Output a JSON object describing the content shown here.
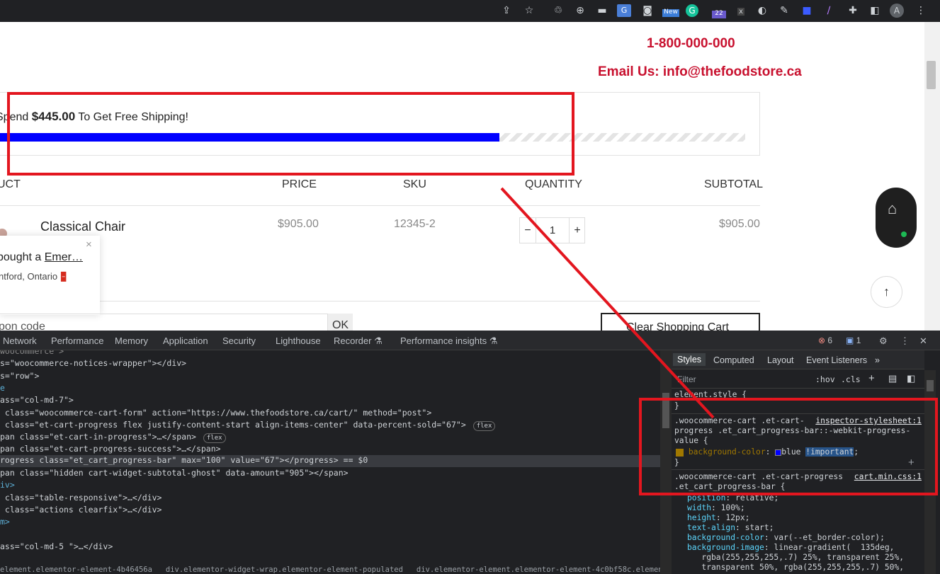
{
  "browser_toolbar": {
    "icons": [
      "share-icon",
      "star-icon",
      "extension-recycle-icon",
      "globe-icon",
      "extension-car-icon",
      "translate-icon",
      "camera-icon",
      "new-extension-icon",
      "grammarly-icon",
      "extension-cap-icon",
      "extension-x-icon",
      "extension-s-icon",
      "pen-icon",
      "video-icon",
      "feather-icon",
      "puzzle-icon",
      "sidebar-icon",
      "profile-avatar",
      "kebab-menu-icon"
    ],
    "new_badge": "New",
    "count_badge": "22",
    "x_badge": "x",
    "avatar_letter": "A"
  },
  "page": {
    "phone": "1-800-000-000",
    "email": "Email Us: info@thefoodstore.ca",
    "shipping": {
      "prefix": "Spend ",
      "amount": "$445.00",
      "suffix": " To Get Free Shipping!",
      "progress_percent": 67
    },
    "table": {
      "headers": [
        "UCT",
        "PRICE",
        "SKU",
        "QUANTITY",
        "SUBTOTAL"
      ],
      "row": {
        "product": "Classical Chair",
        "price": "$905.00",
        "sku": "12345-2",
        "qty": "1",
        "minus": "−",
        "plus": "+",
        "subtotal": "$905.00"
      }
    },
    "notification": {
      "text_prefix": " bought a ",
      "link": "Emer…",
      "location": "ntford, Ontario",
      "close": "×"
    },
    "coupon": {
      "placeholder": "pon code",
      "ok": "OK"
    },
    "clear_cart": "Clear Shopping Cart"
  },
  "devtools": {
    "tabs": [
      "Network",
      "Performance",
      "Memory",
      "Application",
      "Security",
      "Lighthouse",
      "Recorder",
      "Performance insights"
    ],
    "error_count": "6",
    "message_count": "1",
    "elements_lines": [
      "woocommerce >",
      "s=\"woocommerce-notices-wrapper\"></div>",
      "s=\"row\">",
      "e",
      "ass=\"col-md-7\">",
      " class=\"woocommerce-cart-form\" action=\"https://www.thefoodstore.ca/cart/\" method=\"post\">",
      " class=\"et-cart-progress flex justify-content-start align-items-center\" data-percent-sold=\"67\">",
      "pan class=\"et-cart-in-progress\">…</span>",
      "pan class=\"et-cart-progress-success\">…</span>",
      "rogress class=\"et_cart_progress-bar\" max=\"100\" value=\"67\"></progress> == $0",
      "pan class=\"hidden cart-widget-subtotal-ghost\" data-amount=\"905\"></span>",
      "iv>",
      " class=\"table-responsive\">…</div>",
      " class=\"actions clearfix\">…</div>",
      "m>",
      "",
      "ass=\"col-md-5 \">…</div>"
    ],
    "breadcrumb": "element.elementor-element-4b46456a   div.elementor-widget-wrap.elementor-element-populated   div.elementor-element.elementor-element-4c0bf58c.elementor-widg",
    "flex_badge": "flex",
    "styles": {
      "tabs": [
        "Styles",
        "Computed",
        "Layout",
        "Event Listeners"
      ],
      "filter_placeholder": "Filter",
      "hov": ":hov",
      "cls": ".cls",
      "element_style": "element.style {",
      "close_brace": "}",
      "rule1_selector": [
        ".woocommerce-cart .et-cart-",
        "progress .et_cart_progress-bar::-webkit-progress-",
        "value {"
      ],
      "rule1_link": "inspector-stylesheet:1",
      "rule1_prop": "background-color",
      "rule1_value": "blue",
      "rule1_important": "!important",
      "rule2_selector": [
        ".woocommerce-cart .et-cart-progress",
        ".et_cart_progress-bar {"
      ],
      "rule2_link": "cart.min.css:1",
      "rule2_props": [
        [
          "position",
          "relative;"
        ],
        [
          "width",
          "100%;"
        ],
        [
          "height",
          "12px;"
        ],
        [
          "text-align",
          "start;"
        ],
        [
          "background-color",
          "var(--et_border-color);"
        ],
        [
          "background-image",
          "linear-gradient(  135deg,"
        ],
        [
          "",
          "   rgba(255,255,255,.7) 25%, transparent 25%,"
        ],
        [
          "",
          "   transparent 50%, rgba(255,255,255,.7) 50%,"
        ]
      ]
    }
  },
  "colors": {
    "accent_red": "#c8102e",
    "progress_blue": "#0000ff",
    "annotation_red": "#e3161f"
  }
}
